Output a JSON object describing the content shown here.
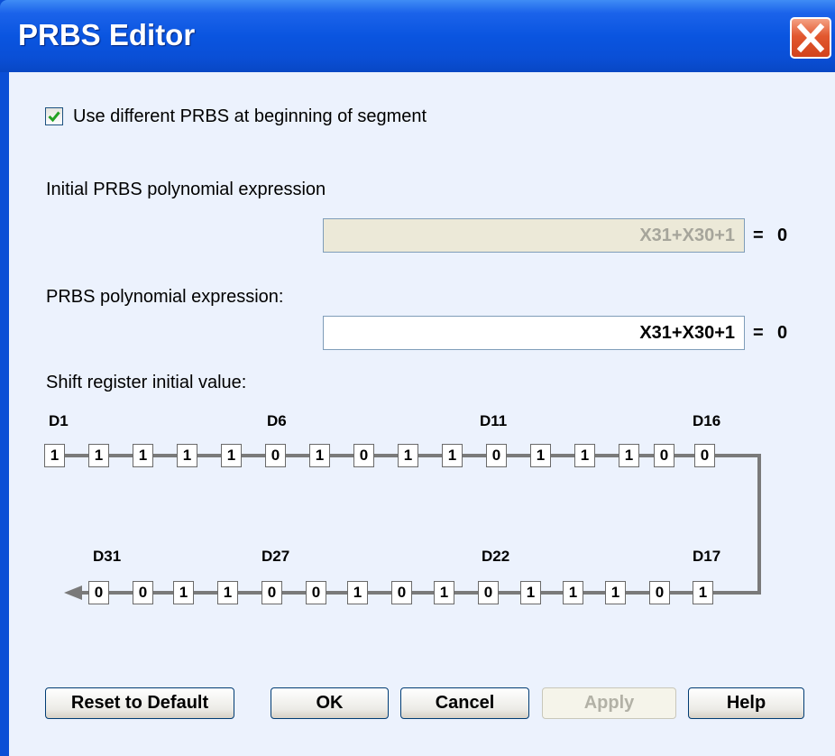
{
  "window": {
    "title": "PRBS Editor",
    "close_icon": "close-icon"
  },
  "checkbox": {
    "label": "Use different PRBS at beginning of segment",
    "checked": true
  },
  "initial": {
    "label": "Initial PRBS polynomial expression",
    "value": "X31+X30+1",
    "result": "0"
  },
  "polynomial": {
    "label": "PRBS polynomial expression:",
    "value": "X31+X30+1",
    "result": "0"
  },
  "shift_register": {
    "label": "Shift register initial value:",
    "top_labels": [
      "D1",
      "D6",
      "D11",
      "D16"
    ],
    "bottom_labels": [
      "D31",
      "D27",
      "D22",
      "D17"
    ],
    "top_values": [
      "1",
      "1",
      "1",
      "1",
      "1",
      "0",
      "1",
      "0",
      "1",
      "1",
      "0",
      "1",
      "1",
      "1",
      "0",
      "0"
    ],
    "bottom_values": [
      "0",
      "0",
      "1",
      "1",
      "0",
      "0",
      "1",
      "0",
      "1",
      "0",
      "1",
      "1",
      "1",
      "0",
      "1"
    ]
  },
  "buttons": {
    "reset": "Reset to Default",
    "ok": "OK",
    "cancel": "Cancel",
    "apply": "Apply",
    "help": "Help"
  },
  "equals": "="
}
